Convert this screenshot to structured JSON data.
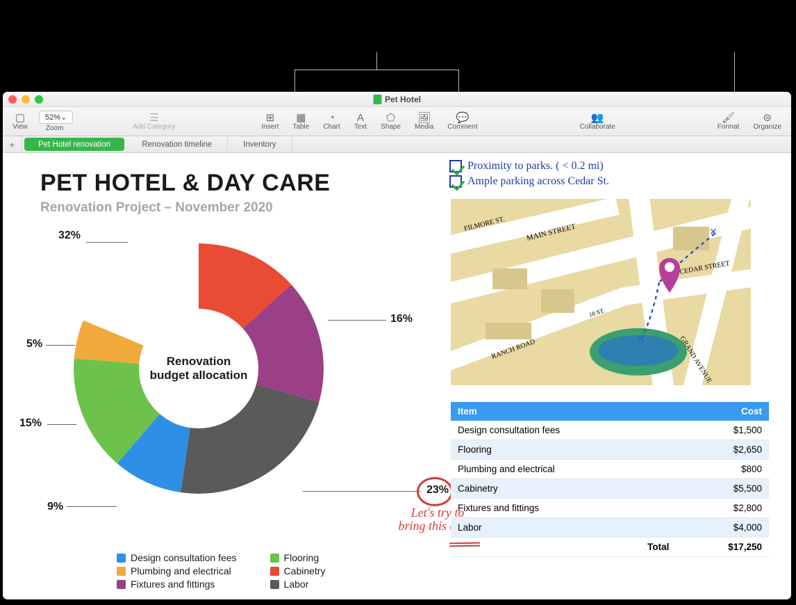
{
  "window": {
    "title": "Pet Hotel"
  },
  "toolbar": {
    "view": "View",
    "zoom_label": "Zoom",
    "zoom_value": "52%⌄",
    "add_category": "Add Category",
    "insert": "Insert",
    "table": "Table",
    "chart": "Chart",
    "text": "Text",
    "shape": "Shape",
    "media": "Media",
    "comment": "Comment",
    "collaborate": "Collaborate",
    "format": "Format",
    "organize": "Organize"
  },
  "sheets": {
    "add": "+",
    "tabs": [
      {
        "label": "Pet Hotel renovation",
        "active": true
      },
      {
        "label": "Renovation timeline",
        "active": false
      },
      {
        "label": "Inventory",
        "active": false
      }
    ]
  },
  "heading": "PET HOTEL & DAY CARE",
  "subheading": "Renovation Project – November 2020",
  "chart_data": {
    "type": "pie",
    "title": "Renovation budget allocation",
    "series": [
      {
        "name": "Design consultation fees",
        "value": 9,
        "color": "#2f8fe4"
      },
      {
        "name": "Flooring",
        "value": 15,
        "color": "#6dc24b"
      },
      {
        "name": "Plumbing and electrical",
        "value": 5,
        "color": "#f2a93c"
      },
      {
        "name": "Cabinetry",
        "value": 32,
        "color": "#e94b35"
      },
      {
        "name": "Fixtures and fittings",
        "value": 16,
        "color": "#9b3f86"
      },
      {
        "name": "Labor",
        "value": 23,
        "color": "#5a5a5a"
      }
    ],
    "labels": {
      "pct32": "32%",
      "pct5": "5%",
      "pct15": "15%",
      "pct9": "9%",
      "pct16": "16%",
      "pct23": "23%"
    }
  },
  "checklist": [
    "Proximity to parks. ( < 0.2 mi)",
    "Ample parking across Cedar St."
  ],
  "map": {
    "streets": [
      "FILMORE ST.",
      "MAIN STREET",
      "CEDAR STREET",
      "RANCH ROAD",
      "GRAND AVENUE",
      "18 ST."
    ]
  },
  "cost_table": {
    "headers": [
      "Item",
      "Cost"
    ],
    "rows": [
      {
        "item": "Design consultation fees",
        "cost": "$1,500"
      },
      {
        "item": "Flooring",
        "cost": "$2,650"
      },
      {
        "item": "Plumbing and electrical",
        "cost": "$800"
      },
      {
        "item": "Cabinetry",
        "cost": "$5,500"
      },
      {
        "item": "Fixtures and fittings",
        "cost": "$2,800"
      },
      {
        "item": "Labor",
        "cost": "$4,000"
      }
    ],
    "total_label": "Total",
    "total_value": "$17,250"
  },
  "annotation": {
    "red_note": "Let's try to bring this down"
  }
}
